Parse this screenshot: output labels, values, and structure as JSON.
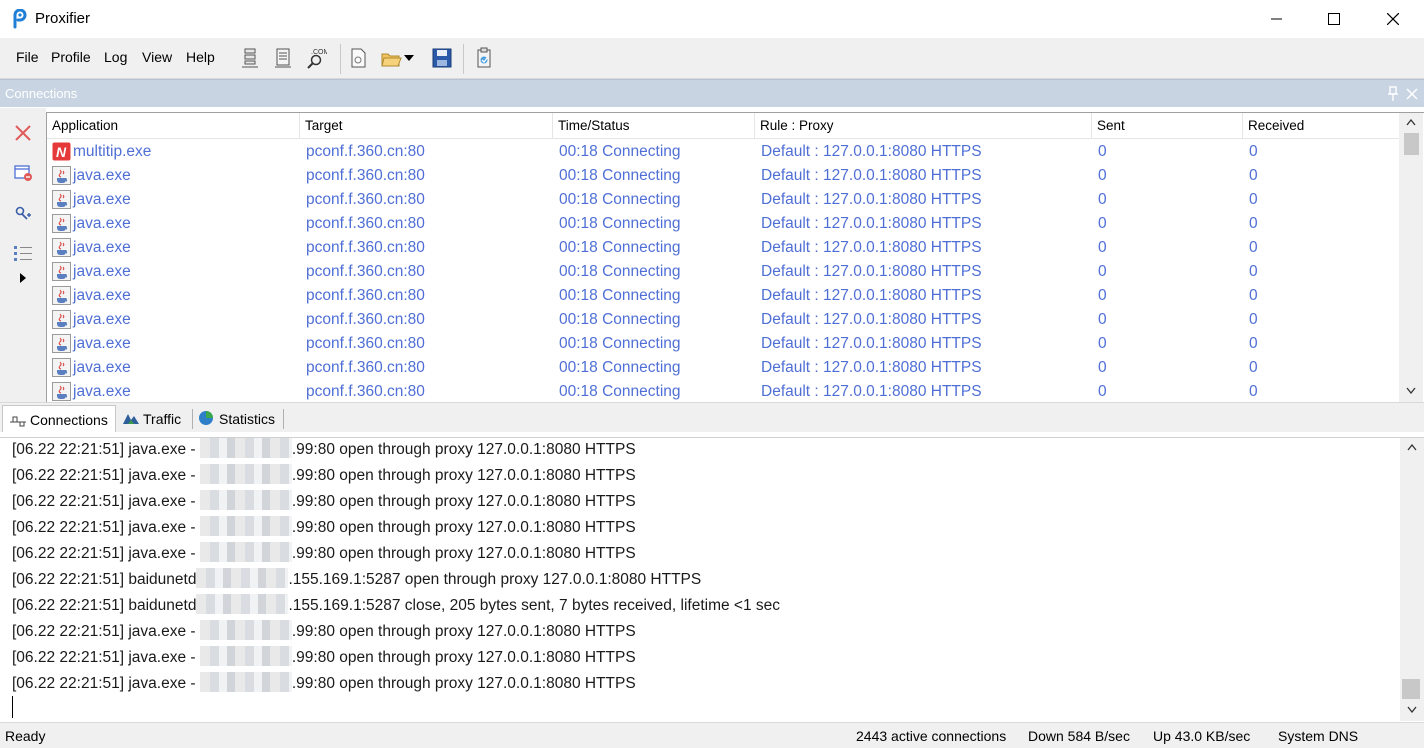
{
  "window": {
    "title": "Proxifier",
    "icon": "proxifier-logo"
  },
  "menu": {
    "file": "File",
    "profile": "Profile",
    "log": "Log",
    "view": "View",
    "help": "Help"
  },
  "toolbar": {
    "icons": [
      "proxy-servers-icon",
      "proxification-rules-icon",
      "name-resolution-icon",
      "new-profile-icon",
      "open-profile-icon",
      "save-profile-icon",
      "advanced-settings-icon"
    ]
  },
  "connections_panel": {
    "title": "Connections"
  },
  "table": {
    "columns": [
      "Application",
      "Target",
      "Time/Status",
      "Rule : Proxy",
      "Sent",
      "Received"
    ],
    "rows": [
      {
        "app": "multitip.exe",
        "icon": "multitip-app-icon",
        "target": "pconf.f.360.cn:80",
        "status": "00:18 Connecting",
        "rule": "Default : 127.0.0.1:8080 HTTPS",
        "sent": "0",
        "received": "0"
      },
      {
        "app": "java.exe",
        "icon": "java-app-icon",
        "target": "pconf.f.360.cn:80",
        "status": "00:18 Connecting",
        "rule": "Default : 127.0.0.1:8080 HTTPS",
        "sent": "0",
        "received": "0"
      },
      {
        "app": "java.exe",
        "icon": "java-app-icon",
        "target": "pconf.f.360.cn:80",
        "status": "00:18 Connecting",
        "rule": "Default : 127.0.0.1:8080 HTTPS",
        "sent": "0",
        "received": "0"
      },
      {
        "app": "java.exe",
        "icon": "java-app-icon",
        "target": "pconf.f.360.cn:80",
        "status": "00:18 Connecting",
        "rule": "Default : 127.0.0.1:8080 HTTPS",
        "sent": "0",
        "received": "0"
      },
      {
        "app": "java.exe",
        "icon": "java-app-icon",
        "target": "pconf.f.360.cn:80",
        "status": "00:18 Connecting",
        "rule": "Default : 127.0.0.1:8080 HTTPS",
        "sent": "0",
        "received": "0"
      },
      {
        "app": "java.exe",
        "icon": "java-app-icon",
        "target": "pconf.f.360.cn:80",
        "status": "00:18 Connecting",
        "rule": "Default : 127.0.0.1:8080 HTTPS",
        "sent": "0",
        "received": "0"
      },
      {
        "app": "java.exe",
        "icon": "java-app-icon",
        "target": "pconf.f.360.cn:80",
        "status": "00:18 Connecting",
        "rule": "Default : 127.0.0.1:8080 HTTPS",
        "sent": "0",
        "received": "0"
      },
      {
        "app": "java.exe",
        "icon": "java-app-icon",
        "target": "pconf.f.360.cn:80",
        "status": "00:18 Connecting",
        "rule": "Default : 127.0.0.1:8080 HTTPS",
        "sent": "0",
        "received": "0"
      },
      {
        "app": "java.exe",
        "icon": "java-app-icon",
        "target": "pconf.f.360.cn:80",
        "status": "00:18 Connecting",
        "rule": "Default : 127.0.0.1:8080 HTTPS",
        "sent": "0",
        "received": "0"
      },
      {
        "app": "java.exe",
        "icon": "java-app-icon",
        "target": "pconf.f.360.cn:80",
        "status": "00:18 Connecting",
        "rule": "Default : 127.0.0.1:8080 HTTPS",
        "sent": "0",
        "received": "0"
      },
      {
        "app": "java.exe",
        "icon": "java-app-icon",
        "target": "pconf.f.360.cn:80",
        "status": "00:18 Connecting",
        "rule": "Default : 127.0.0.1:8080 HTTPS",
        "sent": "0",
        "received": "0"
      }
    ]
  },
  "tabs": [
    {
      "label": "Connections",
      "icon": "connections-tab-icon",
      "active": true
    },
    {
      "label": "Traffic",
      "icon": "traffic-tab-icon",
      "active": false
    },
    {
      "label": "Statistics",
      "icon": "statistics-tab-icon",
      "active": false
    }
  ],
  "log": {
    "lines": [
      {
        "prefix": "[06.22 22:21:51] java.exe - ",
        "suffix": ".99:80 open through proxy 127.0.0.1:8080 HTTPS"
      },
      {
        "prefix": "[06.22 22:21:51] java.exe - ",
        "suffix": ".99:80 open through proxy 127.0.0.1:8080 HTTPS"
      },
      {
        "prefix": "[06.22 22:21:51] java.exe - ",
        "suffix": ".99:80 open through proxy 127.0.0.1:8080 HTTPS"
      },
      {
        "prefix": "[06.22 22:21:51] java.exe - ",
        "suffix": ".99:80 open through proxy 127.0.0.1:8080 HTTPS"
      },
      {
        "prefix": "[06.22 22:21:51] java.exe - ",
        "suffix": ".99:80 open through proxy 127.0.0.1:8080 HTTPS"
      },
      {
        "prefix": "[06.22 22:21:51] baidunetd",
        "suffix": ".155.169.1:5287 open through proxy 127.0.0.1:8080 HTTPS"
      },
      {
        "prefix": "[06.22 22:21:51] baidunetd",
        "suffix": ".155.169.1:5287 close, 205 bytes sent, 7 bytes received, lifetime <1 sec"
      },
      {
        "prefix": "[06.22 22:21:51] java.exe - ",
        "suffix": ".99:80 open through proxy 127.0.0.1:8080 HTTPS"
      },
      {
        "prefix": "[06.22 22:21:51] java.exe - ",
        "suffix": ".99:80 open through proxy 127.0.0.1:8080 HTTPS"
      },
      {
        "prefix": "[06.22 22:21:51] java.exe - ",
        "suffix": ".99:80 open through proxy 127.0.0.1:8080 HTTPS"
      }
    ]
  },
  "status": {
    "ready": "Ready",
    "active_connections": "2443 active connections",
    "down": "Down 584 B/sec",
    "up": "Up 43.0 KB/sec",
    "dns": "System DNS"
  },
  "colors": {
    "link_blue": "#4f6fd6",
    "panel_header": "#c9d4e2",
    "close_red": "#e05a5a"
  }
}
